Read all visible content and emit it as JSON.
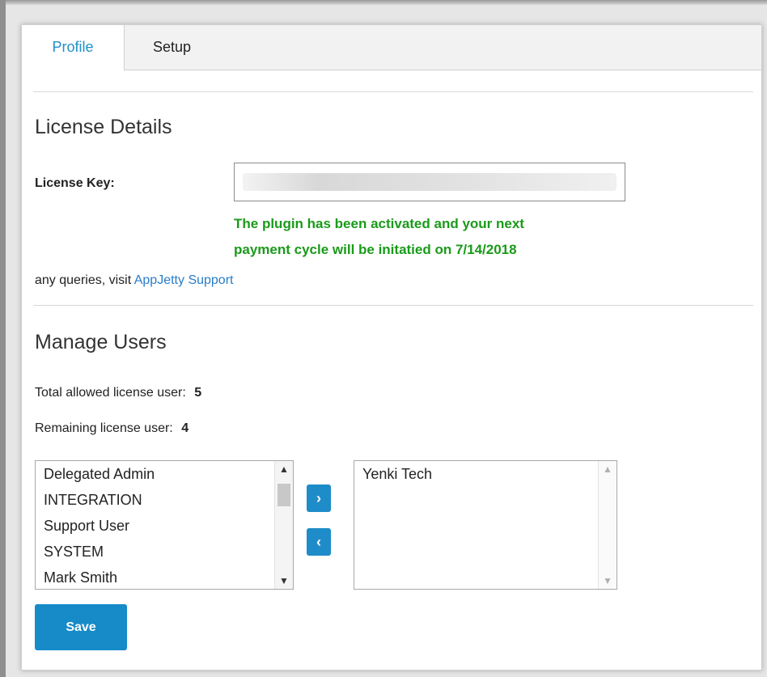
{
  "tabs": [
    {
      "label": "Profile",
      "active": true
    },
    {
      "label": "Setup",
      "active": false
    }
  ],
  "license": {
    "heading": "License Details",
    "key_label": "License Key:",
    "key_value": "",
    "status_line1": "The plugin has been activated and your next",
    "status_line2": "payment cycle will be initatied on 7/14/2018",
    "queries_text": "any queries, visit ",
    "support_link": "AppJetty Support"
  },
  "users": {
    "heading": "Manage Users",
    "total_label": "Total allowed license user:",
    "total_value": "5",
    "remaining_label": "Remaining license user:",
    "remaining_value": "4",
    "available": [
      "Delegated Admin",
      "INTEGRATION",
      "Support User",
      "SYSTEM",
      "Mark Smith"
    ],
    "assigned": [
      "Yenki Tech"
    ],
    "move_right_icon": "chevron-right",
    "move_left_icon": "chevron-left"
  },
  "actions": {
    "save_label": "Save"
  },
  "colors": {
    "accent": "#1e8cc8",
    "success": "#1a9a1a",
    "link": "#2a7cc7"
  }
}
